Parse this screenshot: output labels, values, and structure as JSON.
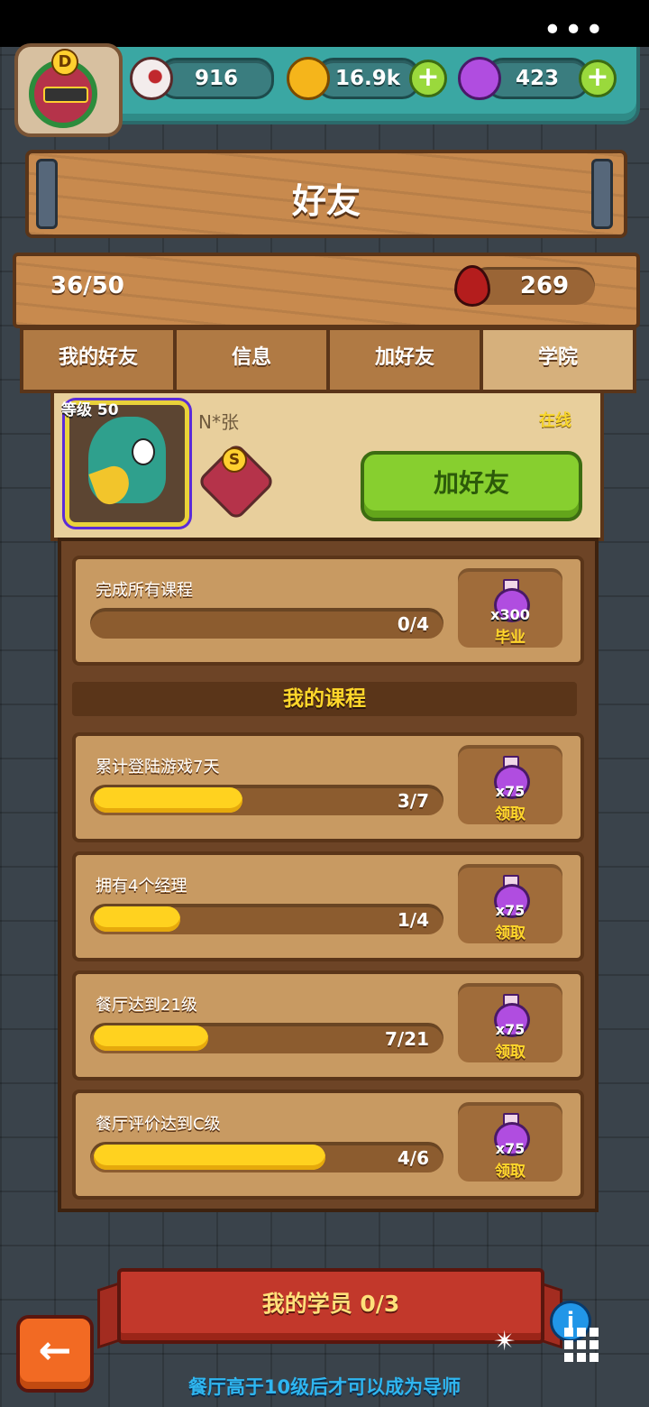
{
  "header": {
    "rank_letter": "D",
    "eyes": "916",
    "coins": "16.9k",
    "potions": "423"
  },
  "title": "好友",
  "stats": {
    "friends": "36/50",
    "blood": "269"
  },
  "tabs": [
    {
      "label": "我的好友"
    },
    {
      "label": "信息"
    },
    {
      "label": "加好友"
    },
    {
      "label": "学院"
    }
  ],
  "profile": {
    "level": "等级 50",
    "name": "N*张",
    "rank_letter": "S",
    "status": "在线",
    "add_label": "加好友"
  },
  "graduation": {
    "label": "完成所有课程",
    "progress": "0/4",
    "fraction": 0,
    "reward_amount": "x300",
    "reward_action": "毕业"
  },
  "section_title": "我的课程",
  "courses": [
    {
      "label": "累计登陆游戏7天",
      "progress": "3/7",
      "fraction": 0.43,
      "reward_amount": "x75",
      "reward_action": "领取"
    },
    {
      "label": "拥有4个经理",
      "progress": "1/4",
      "fraction": 0.25,
      "reward_amount": "x75",
      "reward_action": "领取"
    },
    {
      "label": "餐厅达到21级",
      "progress": "7/21",
      "fraction": 0.33,
      "reward_amount": "x75",
      "reward_action": "领取"
    },
    {
      "label": "餐厅评价达到C级",
      "progress": "4/6",
      "fraction": 0.67,
      "reward_amount": "x75",
      "reward_action": "领取"
    }
  ],
  "students": "我的学员 0/3",
  "bottom_note": "餐厅高于10级后才可以成为导师",
  "icons": {
    "back": "left-arrow-icon",
    "info": "info-icon",
    "grid": "grid-menu-icon",
    "eye": "eye-icon",
    "coin": "coin-icon",
    "potion": "potion-icon",
    "blood": "blood-drop-icon"
  },
  "colors": {
    "accent_green": "#87cf2f",
    "gold": "#ffd21f",
    "wood": "#c88a4e",
    "teal": "#3aa7a3"
  }
}
